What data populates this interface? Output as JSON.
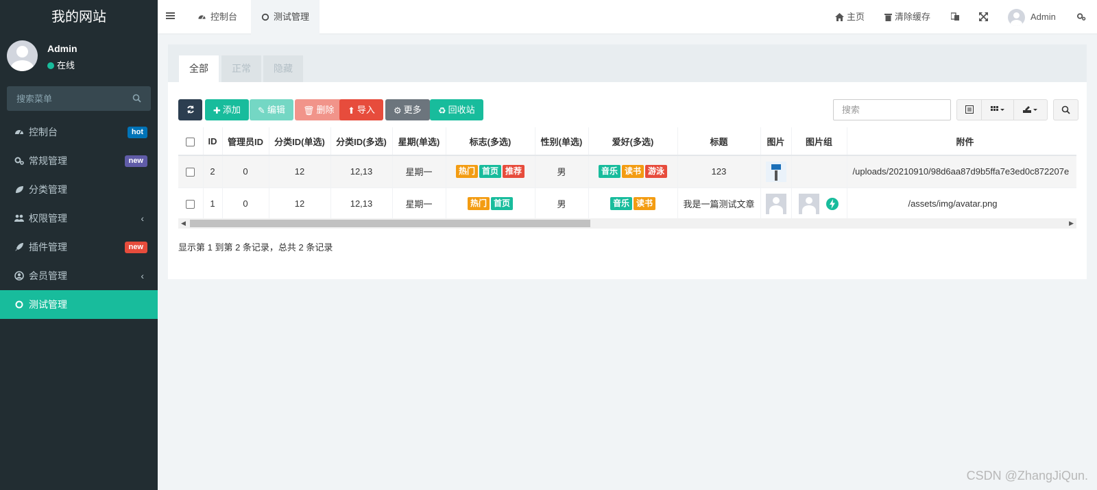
{
  "sidebar": {
    "brand": "我的网站",
    "user": {
      "name": "Admin",
      "status": "在线"
    },
    "search_placeholder": "搜索菜单",
    "items": [
      {
        "label": "控制台",
        "icon": "dashboard-icon",
        "badge": "hot",
        "badge_color": "#0073b7"
      },
      {
        "label": "常规管理",
        "icon": "cogs-icon",
        "badge": "new",
        "badge_color": "#605ca8"
      },
      {
        "label": "分类管理",
        "icon": "leaf-icon"
      },
      {
        "label": "权限管理",
        "icon": "users-icon",
        "chevron": "‹"
      },
      {
        "label": "插件管理",
        "icon": "rocket-icon",
        "badge": "new",
        "badge_color": "#e74c3c"
      },
      {
        "label": "会员管理",
        "icon": "user-circle-icon",
        "chevron": "‹"
      },
      {
        "label": "测试管理",
        "icon": "circle-o-icon",
        "active": true
      }
    ]
  },
  "topbar": {
    "tabs": [
      {
        "label": "控制台"
      },
      {
        "label": "测试管理"
      }
    ],
    "home": "主页",
    "clear_cache": "清除缓存",
    "admin": "Admin"
  },
  "panel": {
    "tabs": [
      "全部",
      "正常",
      "隐藏"
    ],
    "toolbar": {
      "add": "添加",
      "edit": "编辑",
      "delete": "删除",
      "import": "导入",
      "more": "更多",
      "recycle": "回收站"
    },
    "search_placeholder": "搜索",
    "columns": [
      "ID",
      "管理员ID",
      "分类ID(单选)",
      "分类ID(多选)",
      "星期(单选)",
      "标志(多选)",
      "性别(单选)",
      "爱好(多选)",
      "标题",
      "图片",
      "图片组",
      "附件"
    ],
    "rows": [
      {
        "id": "2",
        "admin_id": "0",
        "cat_single": "12",
        "cat_multi": "12,13",
        "week": "星期一",
        "flags": [
          {
            "text": "热门",
            "color": "#f39c12"
          },
          {
            "text": "首页",
            "color": "#18bc9c"
          },
          {
            "text": "推荐",
            "color": "#e74c3c"
          }
        ],
        "gender": "男",
        "hobbies": [
          {
            "text": "音乐",
            "color": "#18bc9c"
          },
          {
            "text": "读书",
            "color": "#f39c12"
          },
          {
            "text": "游泳",
            "color": "#e74c3c"
          }
        ],
        "title": "123",
        "file": "/uploads/20210910/98d6aa87d9b5ffa7e3ed0c872207e"
      },
      {
        "id": "1",
        "admin_id": "0",
        "cat_single": "12",
        "cat_multi": "12,13",
        "week": "星期一",
        "flags": [
          {
            "text": "热门",
            "color": "#f39c12"
          },
          {
            "text": "首页",
            "color": "#18bc9c"
          }
        ],
        "gender": "男",
        "hobbies": [
          {
            "text": "音乐",
            "color": "#18bc9c"
          },
          {
            "text": "读书",
            "color": "#f39c12"
          }
        ],
        "title": "我是一篇测试文章",
        "file": "/assets/img/avatar.png"
      }
    ],
    "footer": "显示第 1 到第 2 条记录，总共 2 条记录"
  },
  "watermark": "CSDN @ZhangJiQun."
}
